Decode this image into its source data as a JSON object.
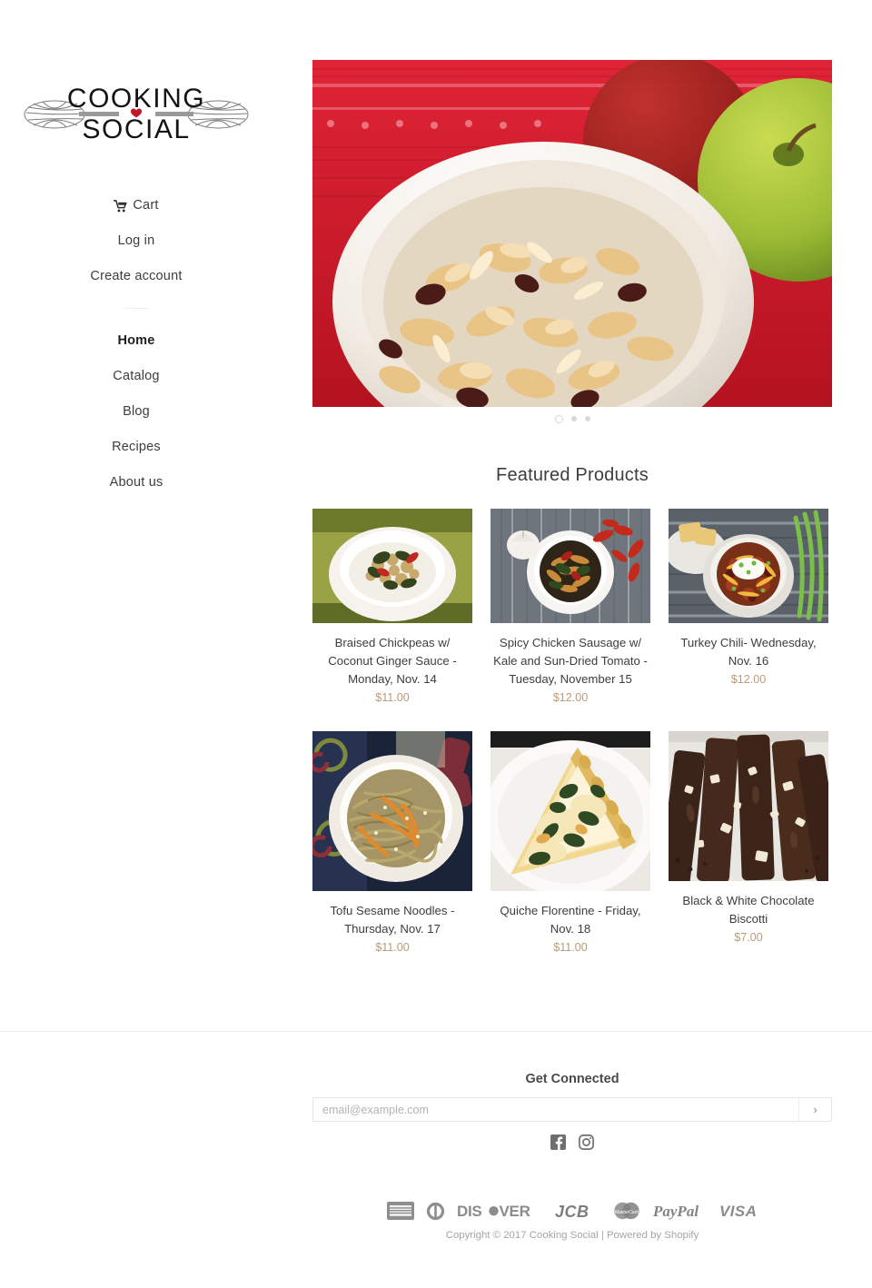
{
  "brand": {
    "name": "COOKING",
    "name2": "SOCIAL",
    "logo_icon": "whisk-logo",
    "heart_color": "#c0182a"
  },
  "sidebar": {
    "utility_items": [
      {
        "label": "Cart",
        "icon": "shopping-cart-icon",
        "name": "cart"
      },
      {
        "label": "Log in",
        "icon": "",
        "name": "log-in"
      },
      {
        "label": "Create account",
        "icon": "",
        "name": "create-account"
      }
    ],
    "main_items": [
      {
        "label": "Home",
        "name": "home",
        "active": true
      },
      {
        "label": "Catalog",
        "name": "catalog",
        "active": false
      },
      {
        "label": "Blog",
        "name": "blog",
        "active": false
      },
      {
        "label": "Recipes",
        "name": "recipes",
        "active": false
      },
      {
        "label": "About us",
        "name": "about-us",
        "active": false
      }
    ]
  },
  "hero": {
    "alt": "granola-bowl-with-apples",
    "slide_count": 3,
    "active_slide": 1
  },
  "featured": {
    "heading": "Featured Products",
    "products": [
      {
        "title": "Braised Chickpeas w/ Coconut Ginger Sauce - Monday, Nov. 14",
        "price": "$11.00",
        "image": "chickpeas-over-rice-bowl"
      },
      {
        "title": "Spicy Chicken Sausage w/ Kale and Sun-Dried Tomato - Tuesday, November 15",
        "price": "$12.00",
        "image": "sausage-kale-bowl-with-garlic"
      },
      {
        "title": "Turkey Chili- Wednesday, Nov. 16",
        "price": "$12.00",
        "image": "turkey-chili-bowl-with-scallions"
      },
      {
        "title": "Tofu Sesame Noodles - Thursday, Nov. 17",
        "price": "$11.00",
        "image": "sesame-noodles-bowl"
      },
      {
        "title": "Quiche Florentine - Friday, Nov. 18",
        "price": "$11.00",
        "image": "quiche-slice-on-plate"
      },
      {
        "title": "Black & White Chocolate Biscotti",
        "price": "$7.00",
        "image": "chocolate-biscotti"
      }
    ]
  },
  "footer": {
    "connect_heading": "Get Connected",
    "email_placeholder": "email@example.com",
    "email_value": "",
    "submit_label": "›",
    "socials": [
      {
        "name": "facebook",
        "icon": "facebook-icon"
      },
      {
        "name": "instagram",
        "icon": "instagram-icon"
      }
    ],
    "payment_methods": [
      {
        "name": "american-express",
        "label": "AMERICAN EXPRESS"
      },
      {
        "name": "diners-club",
        "label": "Diners Club"
      },
      {
        "name": "discover",
        "label": "DISCOVER"
      },
      {
        "name": "jcb",
        "label": "JCB"
      },
      {
        "name": "mastercard",
        "label": "Mastercard"
      },
      {
        "name": "paypal",
        "label": "PayPal"
      },
      {
        "name": "visa",
        "label": "VISA"
      }
    ],
    "copyright": "Copyright © 2017 Cooking Social | Powered by Shopify"
  },
  "colors": {
    "price": "#bb9a77",
    "text": "#3d3d3d",
    "muted": "#a5a5a5"
  }
}
